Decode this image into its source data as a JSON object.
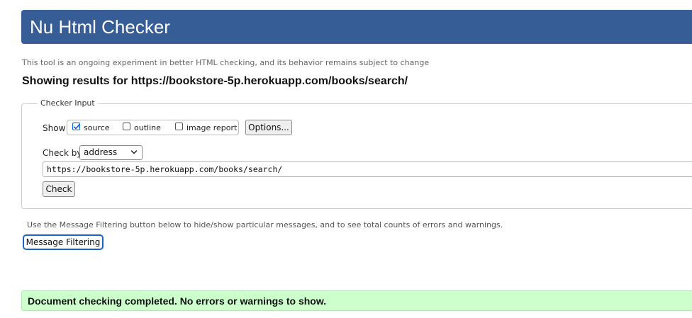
{
  "header": {
    "title": "Nu Html Checker",
    "tagline": "This tool is an ongoing experiment in better HTML checking, and its behavior remains subject to change",
    "results_heading": "Showing results for https://bookstore-5p.herokuapp.com/books/search/"
  },
  "checker_input": {
    "legend": "Checker Input",
    "show_label": "Show",
    "options": [
      {
        "label": "source",
        "checked": true
      },
      {
        "label": "outline",
        "checked": false
      },
      {
        "label": "image report",
        "checked": false
      }
    ],
    "options_button": "Options...",
    "check_by_label": "Check by",
    "check_by_value": "address",
    "url_value": "https://bookstore-5p.herokuapp.com/books/search/",
    "check_button": "Check"
  },
  "filtering": {
    "note": "Use the Message Filtering button below to hide/show particular messages, and to see total counts of errors and warnings.",
    "button": "Message Filtering"
  },
  "result": {
    "message": "Document checking completed. No errors or warnings to show."
  },
  "colors": {
    "banner": "#365d95",
    "success_bg": "#ccffcc",
    "focus_ring": "#1a64c8"
  }
}
